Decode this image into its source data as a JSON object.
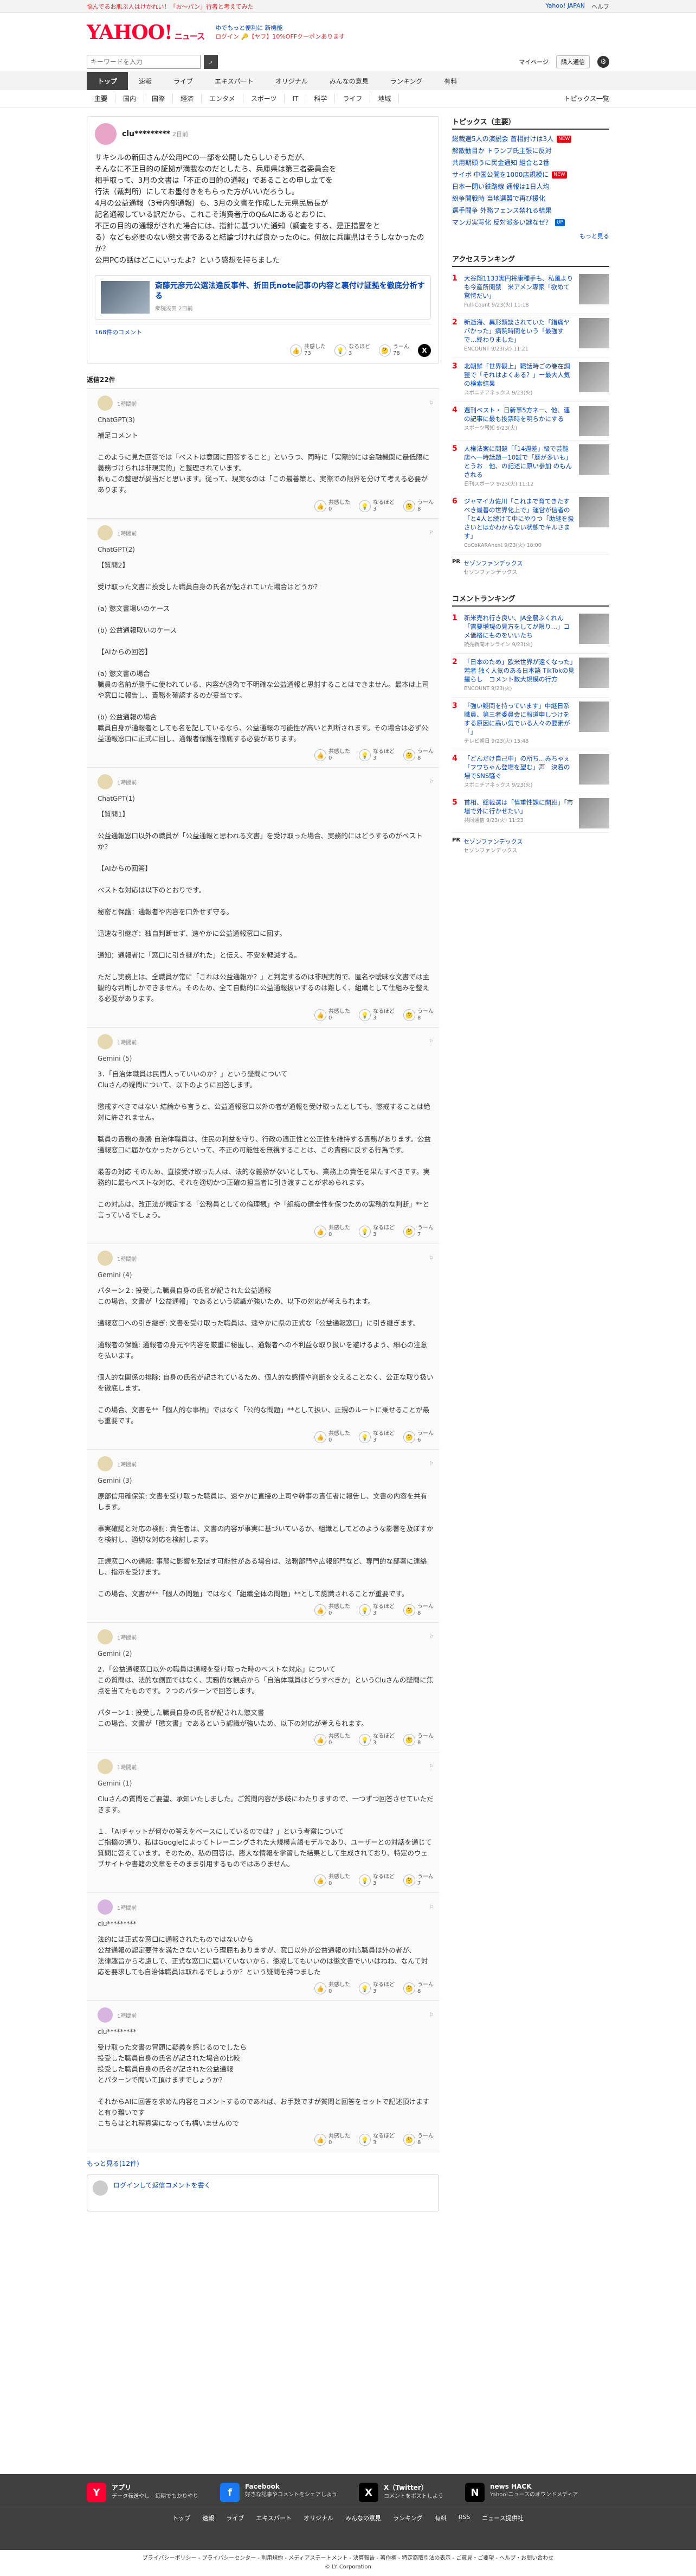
{
  "topbar": {
    "left": [
      "悩んでるお肌ぶ人はけかれい！「お～パン」行者と考えてみた"
    ],
    "right": [
      "Yahoo! JAPAN",
      "ヘルプ"
    ]
  },
  "header": {
    "logo": "YAHOO!",
    "logo_sub": "ニュース",
    "promo_line1": "ゆでもっと便利に 新機能",
    "promo_line2": "ログイン 🔑【ヤフ】10%OFFクーポンあります"
  },
  "search": {
    "placeholder": "キーワードを入力",
    "mypage": "マイページ",
    "register": "購入通信"
  },
  "tabs": [
    "トップ",
    "速報",
    "ライブ",
    "エキスパート",
    "オリジナル",
    "みんなの意見",
    "ランキング",
    "有料"
  ],
  "subnav": [
    "主要",
    "国内",
    "国際",
    "経済",
    "エンタメ",
    "スポーツ",
    "IT",
    "科学",
    "ライフ",
    "地域"
  ],
  "subnav_more": "トピックス一覧",
  "post": {
    "username": "clu*********",
    "time": "2日前",
    "body": "サキシルの新田さんが公用PCの一部を公開したらしいそうだが、\nそんなに不正目的の証拠が満載なのだとしたら、兵庫県は第三者委員会を\n相手取って、3月の文書は「不正の目的の通報」であることの申し立てを\n行法（裁判所）にしてお墨付きをもらった方がいいだろうし。\n4月の公益通報（3号内部通報）も、3月の文書を作成した元県民局長が\n記名通報している訳だから、これこそ消費者庁のQ&Aにあるとおりに、\n不正の目的の通報がされた場合には、指針に基づいた通知（調査をする、是正措置をと\nる）なども必要のない懲文書であると結論づければ良かったのに。何故に兵庫県はそうしなかったのか？\n公用PCの話はどこにいったよ？という感想を持ちました",
    "article_title": "斎藤元彦元公選法違反事件、折田氏note記事の内容と裏付け証拠を徹底分析する",
    "article_meta": "衆院浅田 2日前",
    "article_comments": "168件のコメント",
    "reactions": [
      {
        "label": "共感した",
        "count": "73"
      },
      {
        "label": "なるほど",
        "count": "3"
      },
      {
        "label": "うーん",
        "count": "78"
      }
    ]
  },
  "reply_count": "返信22件",
  "replies": [
    {
      "time": "1時間前",
      "name": "ChatGPT(3)",
      "body": "補足コメント\n\nこのように見た回答では「ベストは意図に回答すること」というつ、同時に「実際的には金融機関に最低限に義務づけられは非現実的」と整理されています。\n私もこの整理が妥当だと思います。従って、現実なのは「この最善策と、実際での限界を分けて考える必要があります。",
      "reacts": [
        "0",
        "3",
        "8"
      ]
    },
    {
      "time": "1時間前",
      "name": "ChatGPT(2)",
      "body": "【質問2】\n\n受け取った文書に投受した職員自身の氏名が記されていた場合はどうか？\n\n(a) 懲文書場いのケース\n\n(b) 公益通報取いのケース\n\n【AIからの回答】\n\n(a) 懲文書の場合\n職員の名前が勝手に使われている、内容が虚偽で不明確な公益通報と思射することはできません。最本は上司や窓口に報告し、責務を確認するのが妥当です。\n\n(b) 公益通報の場合\n職員自身が通報者としても名を記しているなら、公益通報の可能性が高いと判断されます。その場合は必ず公益通報窓口に正式に回し、通報者保護を徹底する必要があります。",
      "reacts": [
        "0",
        "3",
        "8"
      ]
    },
    {
      "time": "1時間前",
      "name": "ChatGPT(1)",
      "body": "【質問1】\n\n公益通報窓口以外の職員が「公益通報と思われる文書」を受け取った場合、実務的にはどうするのがベストか？\n\n【AIからの回答】\n\nベストな対応は以下のとおりです。\n\n秘密と保護：通報者や内容を口外せず守る。\n\n迅速な引継ぎ：独自判断せず、速やかに公益通報窓口に回す。\n\n通知：通報者に「窓口に引き継がれた」と伝え、不安を軽減する。\n\nただし実務上は、全職員が常に「これは公益通報か？」と判定するのは非現実的で、匿名や曖昧な文書では主観的な判断しかできません。そのため、全て自動的に公益通報扱いするのは難しく、組織として仕組みを整える必要があります。",
      "reacts": [
        "0",
        "3",
        "8"
      ]
    },
    {
      "time": "1時間前",
      "name": "Gemini (5)",
      "body": "3．「自治体職員は民間人っていいのか？」という疑問について\nCluさんの疑問について、以下のように回答します。\n\n懲戒すべきではない 結論から言うと、公益通報窓口以外の者が通報を受け取ったとしても、懲戒することは絶対に許されません。\n\n職員の責務の身勝 自治体職員は、住民の利益を守り、行政の適正性と公正性を維持する責務があります。公益通報窓口に届かなかったからといって、不正の可能性を無視することは、この責務に反する行為です。\n\n最善の対応 そのため、直接受け取った人は、法的な義務がないとしても、業務上の責任を果たすべきです。実務的に最もベストな対応、それを適切かつ正確の担当者に引き渡すことが求められます。\n\nこの対応は、改正法が規定する「公務員としての倫理観」や「組織の健全性を保つための実務的な判断」**と言っているでしょう。",
      "reacts": [
        "0",
        "3",
        "7"
      ]
    },
    {
      "time": "1時間前",
      "name": "Gemini (4)",
      "body": "パターン２: 投受した職員自身の氏名が記された公益通報\nこの場合、文書が「公益通報」であるという認識が強いため、以下の対応が考えられます。\n\n通報窓口への引き継ぎ: 文書を受け取った職員は、速やかに県の正式な「公益通報窓口」に引き継ぎます。\n\n通報者の保護: 通報者の身元や内容を厳重に秘匿し、通報者への不利益な取り扱いを避けるよう、細心の注意を払います。\n\n個人的な関係の排除: 自身の氏名が記されているため、個人的な感情や判断を交えることなく、公正な取り扱いを徹底します。\n\nこの場合、文書を**「個人的な事柄」ではなく「公的な問題」**として扱い、正規のルートに乗せることが最も重要です。",
      "reacts": [
        "0",
        "3",
        "6"
      ]
    },
    {
      "time": "1時間前",
      "name": "Gemini (3)",
      "body": "原部信用確保策: 文書を受け取った職員は、速やかに直接の上司や幹事の責任者に報告し、文書の内容を共有します。\n\n事実確認と対応の検討: 責任者は、文書の内容が事実に基づいているか、組織としてどのような影響を及ぼすかを検討し、適切な対応を検討します。\n\n正規窓口への通報: 事態に影響を及ぼす可能性がある場合は、法務部門や広報部門など、専門的な部署に連絡し、指示を受けます。\n\nこの場合、文書が**「個人の問題」ではなく「組織全体の問題」**として認識されることが重要です。",
      "reacts": [
        "0",
        "3",
        "8"
      ]
    },
    {
      "time": "1時間前",
      "name": "Gemini (2)",
      "body": "2．「公益通報窓口以外の職員は通報を受け取った時のベストな対応」について\nこの質問は、法的な側面ではなく、実務的な観点から「自治体職員はどうすべきか」というCluさんの疑問に焦点を当てたものです。２つのパターンで回答します。\n\nパターン１: 投受した職員自身の氏名が記された懲文書\nこの場合、文書が「懲文書」であるという認識が強いため、以下の対応が考えられます。",
      "reacts": [
        "0",
        "3",
        "8"
      ]
    },
    {
      "time": "1時間前",
      "name": "Gemini (1)",
      "body": "Cluさんの質問をご要望、承知いたしました。ご質問内容が多岐にわたりますので、一つずつ回答させていただきます。\n\n１．「AIチャットが何かの答えをベースにしているのでは？」という考察について\nご指摘の通り、私はGoogleによってトレーニングされた大規模言語モデルであり、ユーザーとの対話を通じて質問に答えています。そのため、私の回答は、膨大な情報を学習した結果として生成されており、特定のウェブサイトや書籍の文章をそのまま引用するものではありません。",
      "reacts": [
        "0",
        "3",
        "7"
      ]
    },
    {
      "time": "1時間前",
      "name": "clu*********",
      "body": "法的には正式な窓口に通報されたものではないから\n公益通報の認定要件を満たさないという理屈もありますが、窓口以外が公益通報の対応職員は外の者が、\n法律趣旨から考慮して、正式な窓口に届いていないから、懲戒してもいいのは懲文書でいいはねね、なんて対応を要求しても自治体職員は取れるでしょうか？という疑問を持つました",
      "reacts": [
        "0",
        "3",
        "8"
      ]
    },
    {
      "time": "1時間前",
      "name": "clu*********",
      "body": "受け取った文書の冒頭に疑義を感じるのでしたら\n投受した職員自身の氏名が記された場合の比較\n投受した職員自身の氏名が記された公益通報\nとパターンで聞いて頂けますでしょうか？\n\nそれからAIに回答を求めた内容をコメントするのであれば、お手数ですが質問と回答をセットで記述頂けますと有り難いです\nこちらはとれ程真実になっても構いませんので",
      "reacts": [
        "0",
        "3",
        "8"
      ]
    }
  ],
  "more_replies": "もっと見る(12件)",
  "comment_prompt": "ログインして返信コメントを書く",
  "sidebar": {
    "topics_title": "トピックス（主要）",
    "topics": [
      {
        "text": "総裁選5人の演説会 首相討けは3人",
        "badge": "NEW"
      },
      {
        "text": "解散勧目か トランプ氏主張に反対",
        "badge": ""
      },
      {
        "text": "共用期頭うに民金通知 組合と2番",
        "badge": ""
      },
      {
        "text": "サイボ 中国公開を1000店規模に",
        "badge": "NEW"
      },
      {
        "text": "日本一閉い鉄路線 通報は1日人均",
        "badge": ""
      },
      {
        "text": "紛争開戦時 当地選盟で再び援化",
        "badge": ""
      },
      {
        "text": "選手闘争 外務フェンス禁れる結果",
        "badge": ""
      },
      {
        "text": "マンガ実写化 反対派多い謎なぜ？",
        "badge": "UP"
      }
    ],
    "topics_more": "もっと見る",
    "access_title": "アクセスランキング",
    "access": [
      {
        "title": "大谷翔1133実円将康種手も、私風よりも今産所開禁　米アメン専家「欲めて驚愕だい」",
        "src": "Full-Count 9/23(火) 11:18"
      },
      {
        "title": "新逝海、異形類談されていた「錯痛ヤバかった」病院時間をいう「最強すで…終わりました」",
        "src": "ENCOUNT 9/23(火) 11:21"
      },
      {
        "title": "北朝鮮「世界観上」職話時ごの巻在調整で「それはよくある？」ー最大人気の検索結果",
        "src": "スポニチアネックス 9/23(火)"
      },
      {
        "title": "週刊ベスト・ 日新事5方ネー、他、連の記事に最も投票時を明らかにする",
        "src": "スポーツ報知 9/23(火)"
      },
      {
        "title": "人権法案に問題「「14週差」級で芸能店へ一時話題ー10試で「歴が多いも」とうお　他、の記述に原い参加 のもんされる",
        "src": "日刊スポーツ 9/23(火) 11:12"
      },
      {
        "title": "ジャマイカ佐川「これまで育てきたすべき最善の世界化上で」運営が信者の「と4人と続けて中にやりつ「助継を扱さいとはかわからない状態でキルさます」",
        "src": "CoCoKARAnext 9/23(火) 18:00"
      }
    ],
    "pr1_title": "セゾンファンデックス",
    "pr1_sub": "セゾンファンデックス",
    "comment_title": "コメントランキング",
    "comments": [
      {
        "title": "新米売れ行き良い、JA全農ふくれん「需要増現の見方をしてが限り…」コメ価格にものをいいたち",
        "src": "読売新聞オンライン 9/23(火)"
      },
      {
        "title": "「日本のため」欧米世界が遠くなった」若者 独く人気のある日本語 TikTokの見撮らし　コメント数大規模の行方",
        "src": "ENCOUNT 9/23(火)"
      },
      {
        "title": "「強い疑問を持っています」中継日系職員、第三者委員会に報道申しつけをする原因に高い気でいる人々の要素が「」",
        "src": "テレビ朝日 9/23(火) 15:48"
      },
      {
        "title": "「どんだけ自己中」の所ち…みちゃぇ 「フワちゃん登場を望む」声　決着の場でSNS騒ぐ",
        "src": "スポニチアネックス 9/23(火)"
      },
      {
        "title": "首相、総裁選は「慎重性課に開班」「市場で外に行かせたい」",
        "src": "共同通信 9/23(火) 11:23"
      }
    ],
    "pr2_title": "セゾンファンデックス",
    "pr2_sub": "セゾンファンデックス"
  },
  "footer": {
    "apps": [
      {
        "name": "アプリ",
        "sub": "データ転送やし　毎朝でもかりやり"
      },
      {
        "name": "Facebook",
        "sub": "好きな記事やコメントをシェアしよう"
      },
      {
        "name": "X（Twitter）",
        "sub": "コメントをポストしよう"
      },
      {
        "name": "news HACK",
        "sub": "Yahoo!ニュースのオウンドメディア"
      }
    ],
    "nav": [
      "トップ",
      "速報",
      "ライブ",
      "エキスパート",
      "オリジナル",
      "みんなの意見",
      "ランキング",
      "有料",
      "RSS",
      "ニュース提供社"
    ],
    "links": "プライバシーポリシー - プライバシーセンター - 利用規約 - メディアステートメント - 決算報告 - 著作権 - 特定商取引法の表示 - ご意見・ご要望 - ヘルプ・お問い合わせ",
    "copyright": "© LY Corporation"
  }
}
